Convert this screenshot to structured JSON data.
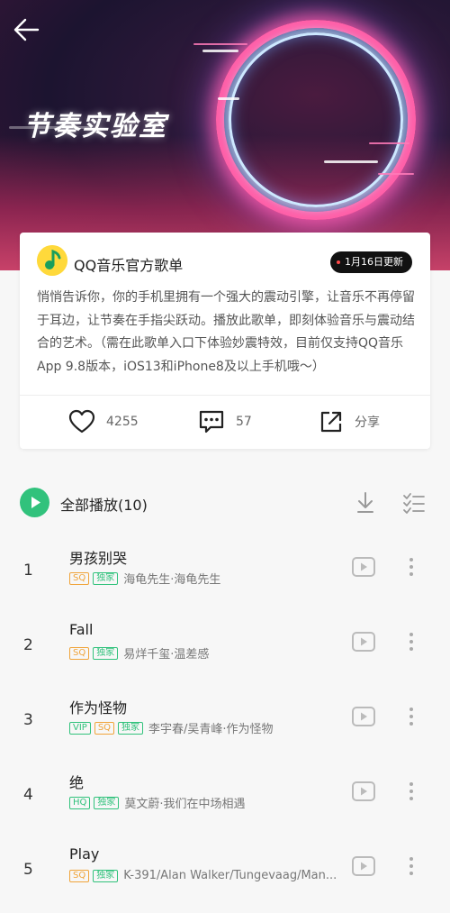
{
  "header": {
    "banner_title": "节奏实验室",
    "back_icon": "arrow-left-icon"
  },
  "playlist": {
    "creator": "QQ音乐官方歌单",
    "update_badge": "1月16日更新",
    "description": "悄悄告诉你，你的手机里拥有一个强大的震动引擎，让音乐不再停留于耳边，让节奏在手指尖跃动。播放此歌单，即刻体验音乐与震动结合的艺术。（需在此歌单入口下体验妙震特效，目前仅支持QQ音乐App 9.8版本，iOS13和iPhone8及以上手机哦～）"
  },
  "actions": {
    "like_count": "4255",
    "comment_count": "57",
    "share_label": "分享"
  },
  "list_header": {
    "play_all_label": "全部播放(10)"
  },
  "songs": [
    {
      "num": "1",
      "title": "男孩别哭",
      "tags": [
        "SQ",
        "独家"
      ],
      "artist": "海龟先生·海龟先生"
    },
    {
      "num": "2",
      "title": "Fall",
      "tags": [
        "SQ",
        "独家"
      ],
      "artist": "易烊千玺·温差感"
    },
    {
      "num": "3",
      "title": "作为怪物",
      "tags": [
        "VIP",
        "SQ",
        "独家"
      ],
      "artist": "李宇春/吴青峰·作为怪物"
    },
    {
      "num": "4",
      "title": "绝",
      "tags": [
        "HQ",
        "独家"
      ],
      "artist": "莫文蔚·我们在中场相遇"
    },
    {
      "num": "5",
      "title": "Play",
      "tags": [
        "SQ",
        "独家"
      ],
      "artist": "K-391/Alan Walker/Tungevaag/Man..."
    }
  ],
  "colors": {
    "accent_green": "#31c27c",
    "sq_orange": "#f0a43a",
    "badge_black": "#111111"
  }
}
